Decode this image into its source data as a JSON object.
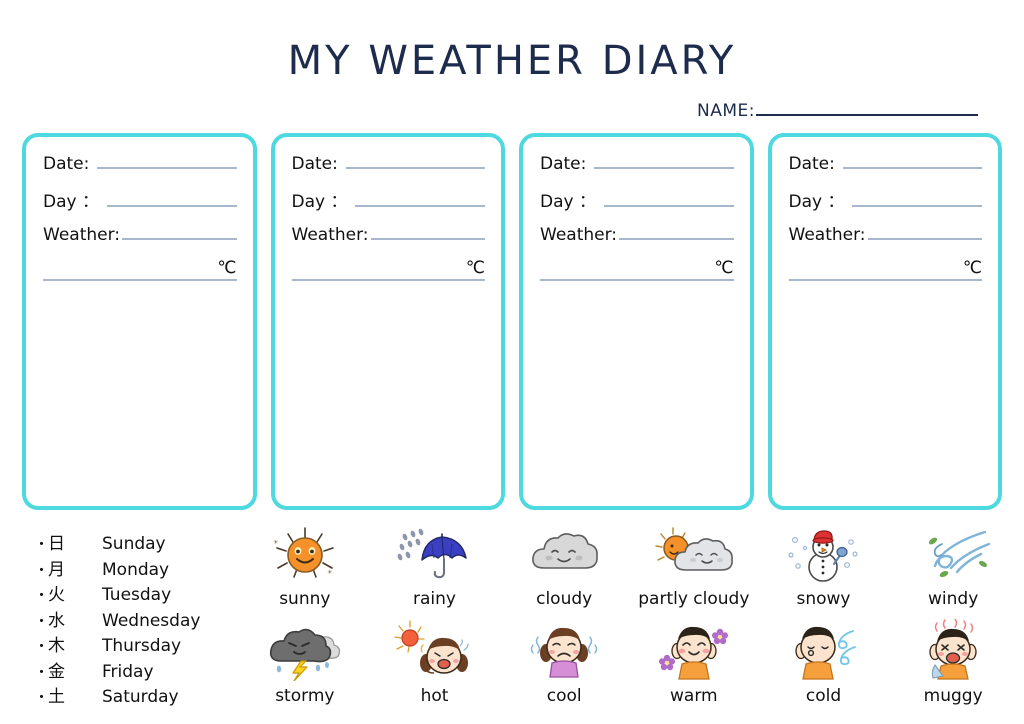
{
  "header": {
    "title": "MY WEATHER DIARY",
    "name_label": "NAME:"
  },
  "cards": [
    {
      "date_label": "Date:",
      "day_label": "Day ：",
      "weather_label": "Weather:",
      "temp_unit": "℃"
    },
    {
      "date_label": "Date:",
      "day_label": "Day ：",
      "weather_label": "Weather:",
      "temp_unit": "℃"
    },
    {
      "date_label": "Date:",
      "day_label": "Day ：",
      "weather_label": "Weather:",
      "temp_unit": "℃"
    },
    {
      "date_label": "Date:",
      "day_label": "Day ：",
      "weather_label": "Weather:",
      "temp_unit": "℃"
    }
  ],
  "days": [
    {
      "bullet": "・",
      "kanji": "日",
      "english": "Sunday"
    },
    {
      "bullet": "・",
      "kanji": "月",
      "english": "Monday"
    },
    {
      "bullet": "・",
      "kanji": "火",
      "english": "Tuesday"
    },
    {
      "bullet": "・",
      "kanji": "水",
      "english": "Wednesday"
    },
    {
      "bullet": "・",
      "kanji": "木",
      "english": "Thursday"
    },
    {
      "bullet": "・",
      "kanji": "金",
      "english": "Friday"
    },
    {
      "bullet": "・",
      "kanji": "土",
      "english": "Saturday"
    }
  ],
  "weather_icons": [
    {
      "label": "sunny",
      "icon": "sun-icon"
    },
    {
      "label": "rainy",
      "icon": "umbrella-rain-icon"
    },
    {
      "label": "cloudy",
      "icon": "cloud-icon"
    },
    {
      "label": "partly cloudy",
      "icon": "sun-behind-cloud-icon"
    },
    {
      "label": "snowy",
      "icon": "snowman-icon"
    },
    {
      "label": "windy",
      "icon": "wind-swirl-icon"
    },
    {
      "label": "stormy",
      "icon": "storm-cloud-lightning-icon"
    },
    {
      "label": "hot",
      "icon": "sweating-face-icon"
    },
    {
      "label": "cool",
      "icon": "shivering-face-icon"
    },
    {
      "label": "warm",
      "icon": "smiling-face-flowers-icon"
    },
    {
      "label": "cold",
      "icon": "cold-face-wind-icon"
    },
    {
      "label": "muggy",
      "icon": "muggy-face-icon"
    }
  ],
  "colors": {
    "title_navy": "#1d2b4c",
    "card_border_cyan": "#4ed8e0",
    "blank_line": "#a9b7cd",
    "sun_orange": "#f5912b",
    "umbrella_blue": "#3b3fc4",
    "cloud_gray": "#d8d8d8",
    "lightning_yellow": "#ffd21e",
    "skin": "#fbe3cd",
    "hair_brown": "#6b3f23",
    "shirt_orange": "#f5a03c",
    "wind_blue": "#6fc6e8",
    "flower_purple": "#b06bc8",
    "hat_red": "#e03131"
  }
}
